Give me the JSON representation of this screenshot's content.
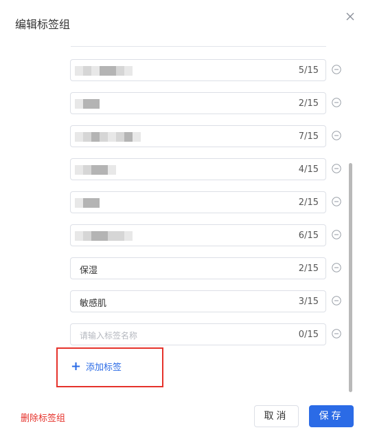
{
  "dialog": {
    "title": "编辑标签组",
    "close_icon": "close-icon"
  },
  "tags": [
    {
      "name": "",
      "count": "5/15",
      "blurred": true
    },
    {
      "name": "",
      "count": "2/15",
      "blurred": true
    },
    {
      "name": "",
      "count": "7/15",
      "blurred": true
    },
    {
      "name": "",
      "count": "4/15",
      "blurred": true
    },
    {
      "name": "",
      "count": "2/15",
      "blurred": true
    },
    {
      "name": "",
      "count": "6/15",
      "blurred": true
    },
    {
      "name": "保湿",
      "count": "2/15",
      "blurred": false
    },
    {
      "name": "敏感肌",
      "count": "3/15",
      "blurred": false
    }
  ],
  "new_tag": {
    "placeholder": "请输入标签名称",
    "count": "0/15"
  },
  "add_tag": {
    "icon": "plus-icon",
    "label": "添加标签"
  },
  "footer": {
    "delete_label": "删除标签组",
    "cancel_label": "取消",
    "save_label": "保存"
  },
  "colors": {
    "primary": "#2b6be6",
    "danger": "#e5312a",
    "border": "#dcdfe6"
  }
}
